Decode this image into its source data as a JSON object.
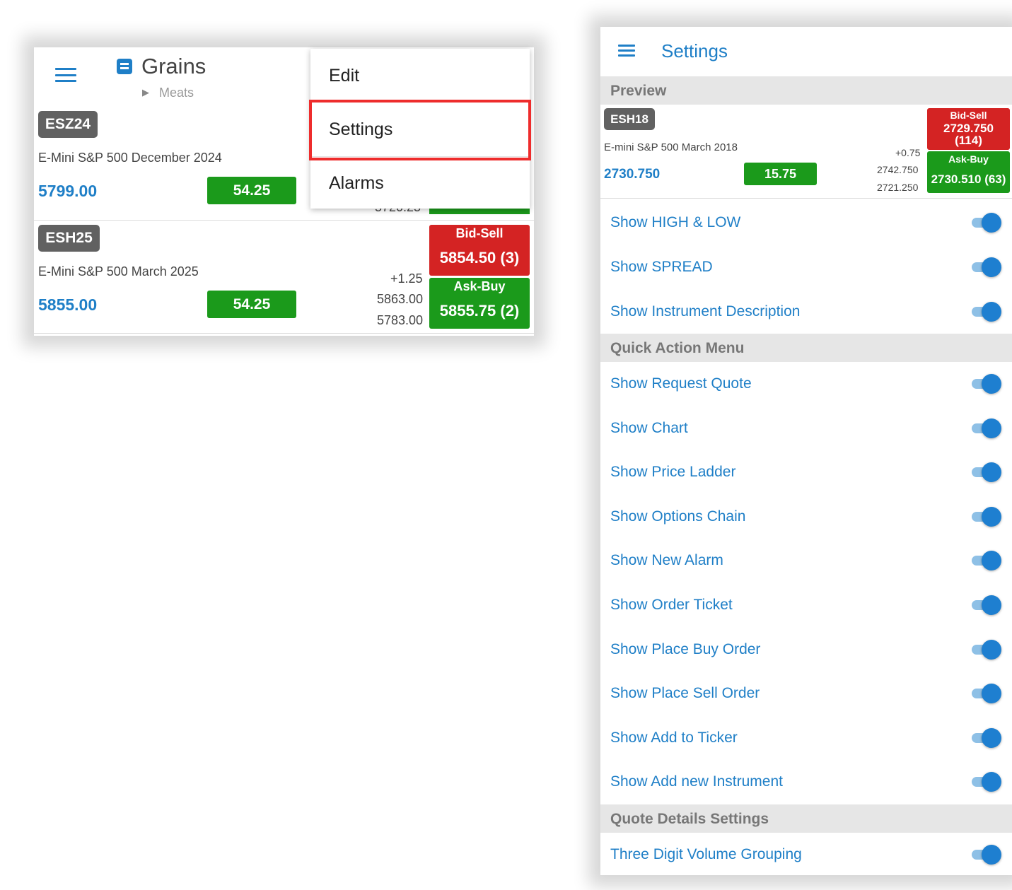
{
  "watchlist": {
    "title": "Grains",
    "breadcrumb": "Meats",
    "instruments": [
      {
        "symbol": "ESZ24",
        "description": "E-Mini S&P 500  December 2024",
        "last": "5799.00",
        "change": "54.25",
        "obscured_low": "5720.25"
      },
      {
        "symbol": "ESH25",
        "description": "E-Mini S&P 500  March 2025",
        "last": "5855.00",
        "change": "54.25",
        "net": "+1.25",
        "high": "5863.00",
        "low": "5783.00",
        "bid_label": "Bid-Sell",
        "bid": "5854.50 (3)",
        "ask_label": "Ask-Buy",
        "ask": "5855.75 (2)"
      }
    ]
  },
  "context_menu": {
    "items": [
      "Edit",
      "Settings",
      "Alarms"
    ],
    "highlighted": "Settings"
  },
  "settings": {
    "title": "Settings",
    "preview": {
      "header": "Preview",
      "symbol": "ESH18",
      "description": "E-mini S&P 500  March 2018",
      "last": "2730.750",
      "change": "15.75",
      "net": "+0.75",
      "high": "2742.750",
      "low": "2721.250",
      "bid_label": "Bid-Sell",
      "bid_price": "2729.750",
      "bid_size": "(114)",
      "ask_label": "Ask-Buy",
      "ask": "2730.510 (63)"
    },
    "general": [
      {
        "label": "Show HIGH & LOW",
        "on": true
      },
      {
        "label": "Show SPREAD",
        "on": true
      },
      {
        "label": "Show Instrument Description",
        "on": true
      }
    ],
    "quick_action_header": "Quick Action Menu",
    "quick_action": [
      {
        "label": "Show Request Quote",
        "on": true
      },
      {
        "label": "Show Chart",
        "on": true
      },
      {
        "label": "Show Price Ladder",
        "on": true
      },
      {
        "label": "Show Options Chain",
        "on": true
      },
      {
        "label": "Show New Alarm",
        "on": true
      },
      {
        "label": "Show Order Ticket",
        "on": true
      },
      {
        "label": "Show Place Buy Order",
        "on": true
      },
      {
        "label": "Show Place Sell Order",
        "on": true
      },
      {
        "label": "Show Add to Ticker",
        "on": true
      },
      {
        "label": "Show Add new Instrument",
        "on": true
      }
    ],
    "quote_details_header": "Quote Details Settings",
    "quote_details": [
      {
        "label": "Three Digit Volume Grouping",
        "on": true
      }
    ]
  },
  "colors": {
    "accent": "#1f7fc7",
    "green": "#1b9a1b",
    "red": "#d42323",
    "highlight": "#ee2c2c"
  }
}
